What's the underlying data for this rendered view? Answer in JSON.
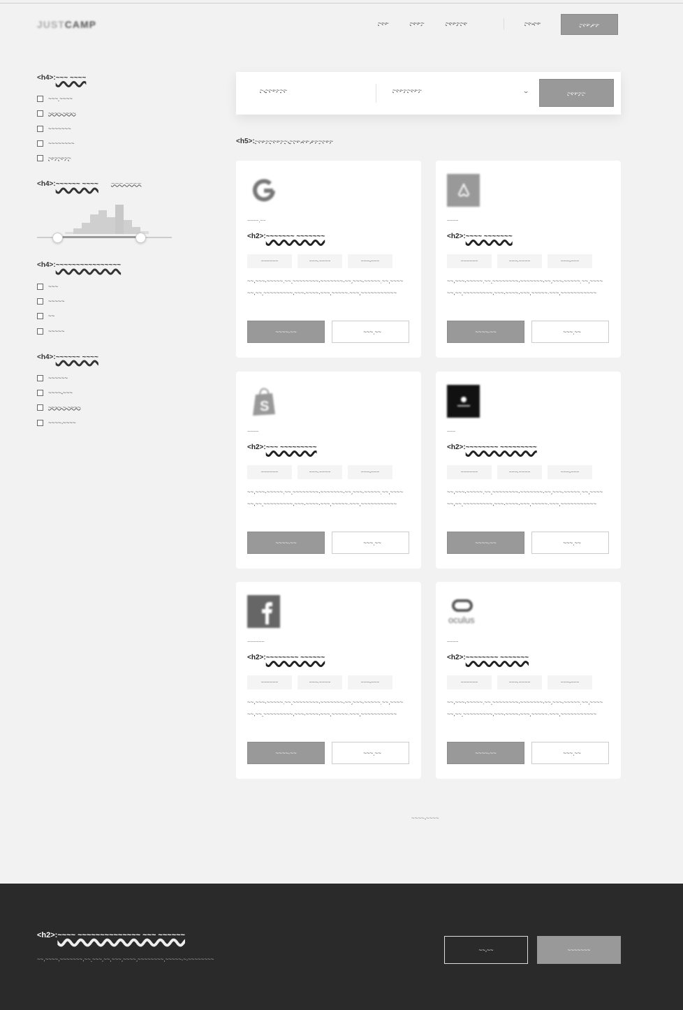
{
  "nav": {
    "logo_light": "JUST",
    "logo_bold": "CAMP",
    "links": [
      "~~~",
      "~~~~",
      "~~~~~~"
    ],
    "icons": [
      "",
      ""
    ],
    "login": "~~ ~~",
    "signup": "~~~ ~~"
  },
  "sidebar": {
    "groups": [
      {
        "title_prefix": "<h4>:",
        "title": "~~~ ~~~~",
        "options": [
          "~~~ ~~~~",
          "~~~~ ~~~~",
          "~~~~~~~",
          "~~~~~~~~",
          "~~~~~~~"
        ]
      },
      {
        "title_prefix": "<h4>:",
        "title": "~~~~~~~~~~~~~~~~",
        "options": [
          "~~~",
          "~~~~~",
          "~~",
          "~~~~~"
        ]
      },
      {
        "title_prefix": "<h4>:",
        "title": "~~~~~~ ~~~~",
        "options": [
          "~~~~~~",
          "~~~~ ~~~",
          "~~~~ ~ ~~~~",
          "~~~~ ~~~~"
        ]
      }
    ],
    "salary": {
      "title_prefix": "<h4>:",
      "title": "~~~~~~ ~~~~",
      "range": "~~~  ~~~~"
    }
  },
  "search": {
    "keyword_icon": "",
    "keyword_value": "~ ~~~~~~",
    "location_icon": "",
    "location_value": "~~~~~~~~",
    "button": "~~~~~"
  },
  "results": {
    "prefix": "<h5>:",
    "text": "~~~~~~~~~ ~~~ ~~ ~~~~~~",
    "view_icons": [
      "",
      ""
    ]
  },
  "jobs": [
    {
      "category": "~~~~ ~~",
      "title_prefix": "<h2>:",
      "title": "~~~~~~~ ~~~~~~~",
      "tags": [
        " ~~~~~~",
        "~~~ ~~~~",
        " ~~~ ~~~"
      ],
      "desc": "~~ ~~~ ~~~~~ ~~ ~~~~~~~~ ~~~~~~~ ~~ ~~~ ~~~~~ ~~ ~~~~ ~~ ~~ ~~~~~~~~~ ~~~ ~~~~ ~~~ ~~~~~ ~~~ ~~~~~~~~~~~",
      "apply": "~~~~ ~~",
      "save": "~~~ ~~"
    },
    {
      "category": "~~~~",
      "title_prefix": "<h2>:",
      "title": "~~~~ ~~~~~~~",
      "tags": [
        " ~~~~~~",
        "~~~ ~~~~",
        " ~~~ ~~~"
      ],
      "desc": "~~ ~~~ ~~~~~ ~~ ~~~~~~~~ ~~~~~~~ ~~ ~~~ ~~~~~ ~~ ~~~~ ~~ ~~ ~~~~~~~~~ ~~~ ~~~~ ~~~ ~~~~~ ~~~ ~~~~~~~~~~~",
      "apply": "~~~~ ~~",
      "save": "~~~ ~~"
    },
    {
      "category": "~~~~",
      "title_prefix": "<h2>:",
      "title": "~~~ ~~~~~~~~~",
      "tags": [
        " ~~~~~~",
        "~~~ ~~~~",
        " ~~~ ~~~"
      ],
      "desc": "~~ ~~~ ~~~~~ ~~ ~~~~~~~~ ~~~~~~~ ~~ ~~~ ~~~~~ ~~ ~~~~ ~~ ~~ ~~~~~~~~~ ~~~ ~~~~ ~~~ ~~~~~ ~~~ ~~~~~~~~~~~",
      "apply": "~~~~ ~~",
      "save": "~~~ ~~"
    },
    {
      "category": "~~~",
      "title_prefix": "<h2>:",
      "title": "~~~~~~~~ ~~~~~~~~~",
      "tags": [
        " ~~~~~~",
        "~~~ ~~~~",
        " ~~~ ~~~"
      ],
      "desc": "~~ ~~~ ~~~~~ ~~ ~~~~~~~~ ~~~~~~~ ~~ ~~~ ~~~~~ ~~ ~~~~ ~~ ~~ ~~~~~~~~~ ~~~ ~~~~ ~~~ ~~~~~ ~~~ ~~~~~~~~~~~",
      "apply": "~~~~ ~~",
      "save": "~~~ ~~"
    },
    {
      "category": "~~~~~~",
      "title_prefix": "<h2>:",
      "title": "~~~~~~~~ ~~~~~~",
      "tags": [
        " ~~~~~~",
        "~~~ ~~~~",
        " ~~~ ~~~"
      ],
      "desc": "~~ ~~~ ~~~~~ ~~ ~~~~~~~~ ~~~~~~~ ~~ ~~~ ~~~~~ ~~ ~~~~ ~~ ~~ ~~~~~~~~~ ~~~ ~~~~ ~~~ ~~~~~ ~~~ ~~~~~~~~~~~",
      "apply": "~~~~ ~~",
      "save": "~~~ ~~"
    },
    {
      "category": "~~~~",
      "title_prefix": "<h2>:",
      "title": "~~~~~~~~ ~~~~~~~",
      "tags": [
        " ~~~~~~",
        "~~~ ~~~~",
        " ~~~ ~~~"
      ],
      "desc": "~~ ~~~ ~~~~~ ~~ ~~~~~~~~ ~~~~~~~ ~~ ~~~ ~~~~~ ~~ ~~~~ ~~ ~~ ~~~~~~~~~ ~~~ ~~~~ ~~~ ~~~~~ ~~~ ~~~~~~~~~~~",
      "apply": "~~~~ ~~",
      "save": "~~~ ~~"
    }
  ],
  "pagination": {
    "label": "~~~~ ~~~~ "
  },
  "footer": {
    "title_prefix": "<h2>:",
    "title": "~~~~ ~~~~~~~~~~~~~~ ~~~ ~~~~~~",
    "subtitle": "~~ ~~~~ ~~~~~~~ ~~ ~~~ ~~ ~~~ ~~~~ ~~~~~~~~ ~~~~~ ~ ~~~~~~~~",
    "outline_button": "~~ ~~",
    "fill_button": "~~~~~~~"
  },
  "colors": {
    "page_bg": "#f2f2f2",
    "accent_gray": "#999999",
    "footer_bg": "#2a2a2a"
  },
  "icon_names": {
    "nav": [
      "briefcase-icon",
      "user-icon"
    ],
    "search": [
      "search-icon",
      "location-pin-icon"
    ],
    "views": [
      "grid-view-icon",
      "list-view-icon"
    ],
    "save": "bookmark-icon",
    "tags": [
      "location-icon",
      "clock-icon",
      "salary-icon"
    ],
    "pagination": "chevron-right-icon"
  }
}
